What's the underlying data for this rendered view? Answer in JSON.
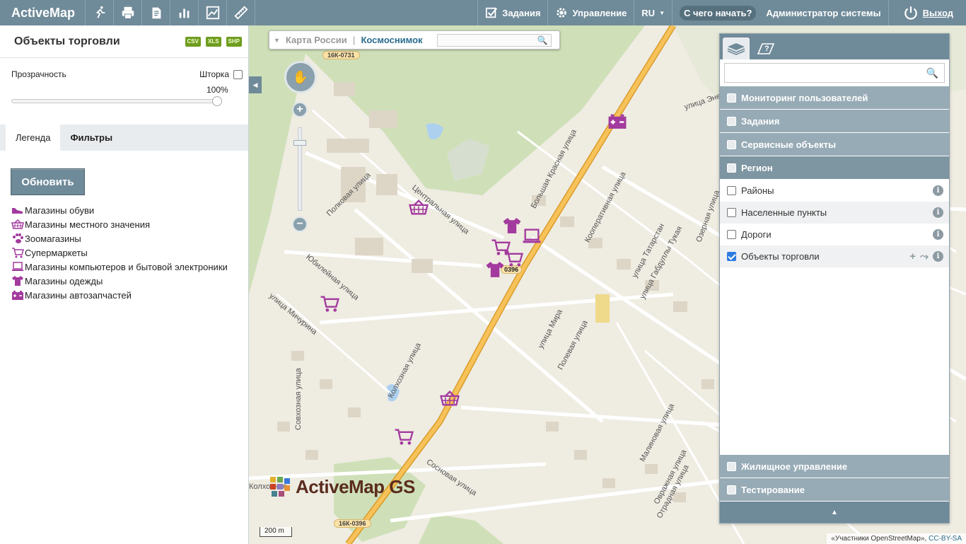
{
  "topbar": {
    "logo": "ActiveMap",
    "tools": [
      "runner-icon",
      "printer-icon",
      "document-icon",
      "bar-chart-icon",
      "line-chart-icon",
      "ruler-icon"
    ],
    "tasks_label": "Задания",
    "management_label": "Управление",
    "lang": "RU",
    "help_label": "С чего начать?",
    "user": "Администратор системы",
    "logout": "Выход"
  },
  "left": {
    "title": "Объекты торговли",
    "exports": [
      "CSV",
      "XLS",
      "SHP"
    ],
    "opacity_label": "Прозрачность",
    "shutter_label": "Шторка",
    "opacity_value": "100%",
    "opacity_fraction": 1.0,
    "tabs": [
      "Легенда",
      "Фильтры"
    ],
    "refresh_label": "Обновить",
    "legend": [
      {
        "icon": "shoe-icon",
        "label": "Магазины обуви"
      },
      {
        "icon": "basket-icon",
        "label": "Магазины местного значения"
      },
      {
        "icon": "paw-icon",
        "label": "Зоомагазины"
      },
      {
        "icon": "cart-icon",
        "label": "Супермаркеты"
      },
      {
        "icon": "laptop-icon",
        "label": "Магазины компьютеров и бытовой электроники"
      },
      {
        "icon": "shirt-icon",
        "label": "Магазины одежды"
      },
      {
        "icon": "battery-icon",
        "label": "Магазины автозапчастей"
      }
    ]
  },
  "map": {
    "basemap_russia": "Карта России",
    "basemap_sat": "Космоснимок",
    "road1": "16К-0731",
    "road2": "16К-0396",
    "road3": "0396",
    "logo_text": "ActiveMap GS",
    "scale": "200 m",
    "attribution": "«Участники OpenStreetMap»,",
    "license": "CC-BY-SA",
    "streets": [
      "Полковая улица",
      "Центральная улица",
      "Большая Красная улица",
      "Кооперативная улица",
      "улица Энергетиков",
      "улица Татарстан",
      "Юбилейная улица",
      "улица Мичурина",
      "Колхозная улица",
      "Совхозная улица",
      "Сосновая улица",
      "улица Мира",
      "Полевая улица",
      "Малиновая улица",
      "Овражная улица",
      "Отрадная улица",
      "улица Габдуллы Тукая",
      "Озерная улица",
      "Колхозная"
    ]
  },
  "layers": {
    "top_groups": [
      "Мониторинг пользователей",
      "Задания",
      "Сервисные объекты"
    ],
    "active_group": "Регион",
    "items": [
      {
        "label": "Районы",
        "checked": false
      },
      {
        "label": "Населенные пункты",
        "checked": false
      },
      {
        "label": "Дороги",
        "checked": false
      },
      {
        "label": "Объекты торговли",
        "checked": true
      }
    ],
    "bottom_groups": [
      "Жилищное управление",
      "Тестирование"
    ],
    "info_glyph": "i",
    "add_glyph": "+",
    "route_glyph": "⤳"
  },
  "colors": {
    "accent": "#6f8a99",
    "poi": "#a33a9e",
    "road": "#f5b83d"
  }
}
